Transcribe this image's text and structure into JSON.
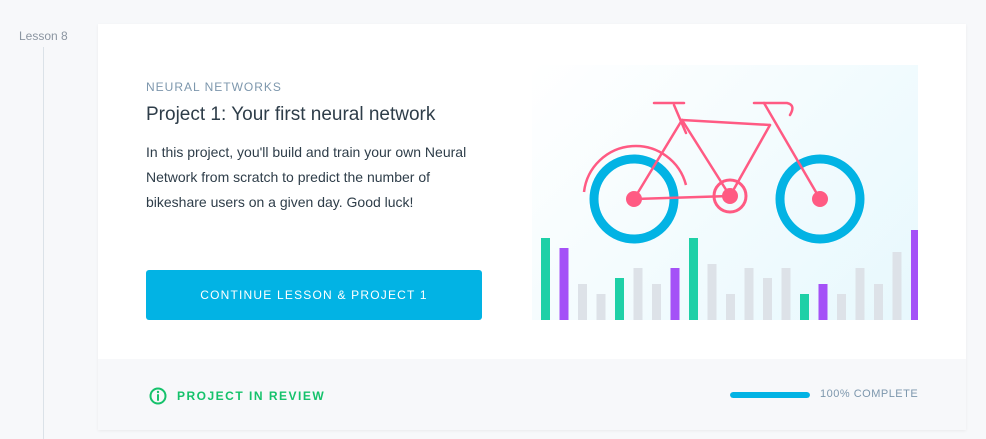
{
  "sidebar": {
    "lesson_label": "Lesson 8"
  },
  "card": {
    "eyebrow": "NEURAL NETWORKS",
    "title": "Project 1: Your first neural network",
    "description": "In this project, you'll build and train your own Neural Network from scratch to predict the number of bikeshare users on a given day. Good luck!",
    "cta_label": "CONTINUE LESSON & PROJECT 1",
    "hero_image": "bicycle-illustration"
  },
  "footer": {
    "status_icon": "info-circle-icon",
    "status_text": "PROJECT IN REVIEW",
    "progress_fraction": 1.0,
    "progress_text": "100% COMPLETE"
  },
  "colors": {
    "accent": "#02b3e4",
    "success": "#15c26b",
    "bike_frame": "#ff5a83",
    "bar_green": "#1ed0a7",
    "bar_purple": "#a451f7",
    "bar_gray": "#dde2e8"
  }
}
